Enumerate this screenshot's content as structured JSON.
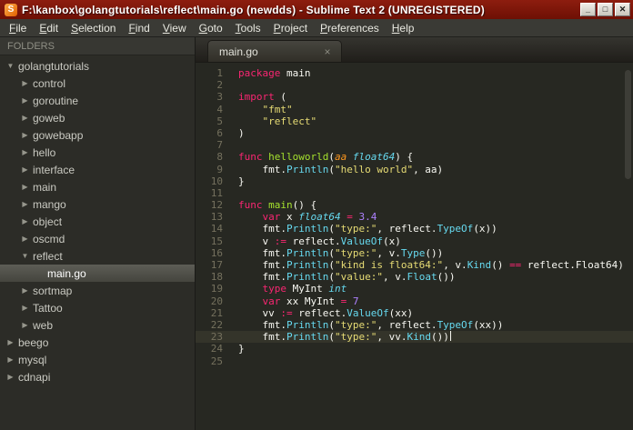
{
  "window": {
    "title": "F:\\kanbox\\golangtutorials\\reflect\\main.go (newdds) - Sublime Text 2 (UNREGISTERED)",
    "app_icon_letter": "S",
    "minimize_label": "_",
    "maximize_label": "□",
    "close_label": "✕"
  },
  "menu": {
    "items": [
      "File",
      "Edit",
      "Selection",
      "Find",
      "View",
      "Goto",
      "Tools",
      "Project",
      "Preferences",
      "Help"
    ]
  },
  "sidebar": {
    "header": "FOLDERS",
    "items": [
      {
        "label": "golangtutorials",
        "depth": 0,
        "type": "folder",
        "expanded": true
      },
      {
        "label": "control",
        "depth": 1,
        "type": "folder",
        "expanded": false
      },
      {
        "label": "goroutine",
        "depth": 1,
        "type": "folder",
        "expanded": false
      },
      {
        "label": "goweb",
        "depth": 1,
        "type": "folder",
        "expanded": false
      },
      {
        "label": "gowebapp",
        "depth": 1,
        "type": "folder",
        "expanded": false
      },
      {
        "label": "hello",
        "depth": 1,
        "type": "folder",
        "expanded": false
      },
      {
        "label": "interface",
        "depth": 1,
        "type": "folder",
        "expanded": false
      },
      {
        "label": "main",
        "depth": 1,
        "type": "folder",
        "expanded": false
      },
      {
        "label": "mango",
        "depth": 1,
        "type": "folder",
        "expanded": false
      },
      {
        "label": "object",
        "depth": 1,
        "type": "folder",
        "expanded": false
      },
      {
        "label": "oscmd",
        "depth": 1,
        "type": "folder",
        "expanded": false
      },
      {
        "label": "reflect",
        "depth": 1,
        "type": "folder",
        "expanded": true
      },
      {
        "label": "main.go",
        "depth": 2,
        "type": "file",
        "selected": true
      },
      {
        "label": "sortmap",
        "depth": 1,
        "type": "folder",
        "expanded": false
      },
      {
        "label": "Tattoo",
        "depth": 1,
        "type": "folder",
        "expanded": false
      },
      {
        "label": "web",
        "depth": 1,
        "type": "folder",
        "expanded": false
      },
      {
        "label": "beego",
        "depth": 0,
        "type": "folder",
        "expanded": false
      },
      {
        "label": "mysql",
        "depth": 0,
        "type": "folder",
        "expanded": false
      },
      {
        "label": "cdnapi",
        "depth": 0,
        "type": "folder",
        "expanded": false
      }
    ]
  },
  "tabs": [
    {
      "label": "main.go",
      "close": "×",
      "active": true
    }
  ],
  "editor": {
    "language": "go",
    "current_line": 23,
    "lines": [
      {
        "num": 1,
        "tokens": [
          {
            "c": "kw",
            "t": "package"
          },
          {
            "c": "pl",
            "t": " main"
          }
        ]
      },
      {
        "num": 2,
        "tokens": []
      },
      {
        "num": 3,
        "tokens": [
          {
            "c": "kw",
            "t": "import"
          },
          {
            "c": "pl",
            "t": " ("
          }
        ]
      },
      {
        "num": 4,
        "tokens": [
          {
            "c": "pl",
            "t": "    "
          },
          {
            "c": "st",
            "t": "\"fmt\""
          }
        ]
      },
      {
        "num": 5,
        "tokens": [
          {
            "c": "pl",
            "t": "    "
          },
          {
            "c": "st",
            "t": "\"reflect\""
          }
        ]
      },
      {
        "num": 6,
        "tokens": [
          {
            "c": "pl",
            "t": ")"
          }
        ]
      },
      {
        "num": 7,
        "tokens": []
      },
      {
        "num": 8,
        "tokens": [
          {
            "c": "kw",
            "t": "func"
          },
          {
            "c": "pl",
            "t": " "
          },
          {
            "c": "fn",
            "t": "helloworld"
          },
          {
            "c": "pl",
            "t": "("
          },
          {
            "c": "pa",
            "t": "aa"
          },
          {
            "c": "pl",
            "t": " "
          },
          {
            "c": "ty",
            "t": "float64"
          },
          {
            "c": "pl",
            "t": ") {"
          }
        ]
      },
      {
        "num": 9,
        "tokens": [
          {
            "c": "pl",
            "t": "    fmt."
          },
          {
            "c": "cy",
            "t": "Println"
          },
          {
            "c": "pl",
            "t": "("
          },
          {
            "c": "st",
            "t": "\"hello world\""
          },
          {
            "c": "pl",
            "t": ", aa)"
          }
        ]
      },
      {
        "num": 10,
        "tokens": [
          {
            "c": "pl",
            "t": "}"
          }
        ]
      },
      {
        "num": 11,
        "tokens": []
      },
      {
        "num": 12,
        "tokens": [
          {
            "c": "kw",
            "t": "func"
          },
          {
            "c": "pl",
            "t": " "
          },
          {
            "c": "fn",
            "t": "main"
          },
          {
            "c": "pl",
            "t": "() {"
          }
        ]
      },
      {
        "num": 13,
        "tokens": [
          {
            "c": "pl",
            "t": "    "
          },
          {
            "c": "kw",
            "t": "var"
          },
          {
            "c": "pl",
            "t": " x "
          },
          {
            "c": "ty",
            "t": "float64"
          },
          {
            "c": "pl",
            "t": " "
          },
          {
            "c": "kw",
            "t": "="
          },
          {
            "c": "pl",
            "t": " "
          },
          {
            "c": "nu",
            "t": "3.4"
          }
        ]
      },
      {
        "num": 14,
        "tokens": [
          {
            "c": "pl",
            "t": "    fmt."
          },
          {
            "c": "cy",
            "t": "Println"
          },
          {
            "c": "pl",
            "t": "("
          },
          {
            "c": "st",
            "t": "\"type:\""
          },
          {
            "c": "pl",
            "t": ", reflect."
          },
          {
            "c": "cy",
            "t": "TypeOf"
          },
          {
            "c": "pl",
            "t": "(x))"
          }
        ]
      },
      {
        "num": 15,
        "tokens": [
          {
            "c": "pl",
            "t": "    v "
          },
          {
            "c": "kw",
            "t": ":="
          },
          {
            "c": "pl",
            "t": " reflect."
          },
          {
            "c": "cy",
            "t": "ValueOf"
          },
          {
            "c": "pl",
            "t": "(x)"
          }
        ]
      },
      {
        "num": 16,
        "tokens": [
          {
            "c": "pl",
            "t": "    fmt."
          },
          {
            "c": "cy",
            "t": "Println"
          },
          {
            "c": "pl",
            "t": "("
          },
          {
            "c": "st",
            "t": "\"type:\""
          },
          {
            "c": "pl",
            "t": ", v."
          },
          {
            "c": "cy",
            "t": "Type"
          },
          {
            "c": "pl",
            "t": "())"
          }
        ]
      },
      {
        "num": 17,
        "tokens": [
          {
            "c": "pl",
            "t": "    fmt."
          },
          {
            "c": "cy",
            "t": "Println"
          },
          {
            "c": "pl",
            "t": "("
          },
          {
            "c": "st",
            "t": "\"kind is float64:\""
          },
          {
            "c": "pl",
            "t": ", v."
          },
          {
            "c": "cy",
            "t": "Kind"
          },
          {
            "c": "pl",
            "t": "() "
          },
          {
            "c": "kw",
            "t": "=="
          },
          {
            "c": "pl",
            "t": " reflect.Float64)"
          }
        ]
      },
      {
        "num": 18,
        "tokens": [
          {
            "c": "pl",
            "t": "    fmt."
          },
          {
            "c": "cy",
            "t": "Println"
          },
          {
            "c": "pl",
            "t": "("
          },
          {
            "c": "st",
            "t": "\"value:\""
          },
          {
            "c": "pl",
            "t": ", v."
          },
          {
            "c": "cy",
            "t": "Float"
          },
          {
            "c": "pl",
            "t": "())"
          }
        ]
      },
      {
        "num": 19,
        "tokens": [
          {
            "c": "pl",
            "t": "    "
          },
          {
            "c": "kw",
            "t": "type"
          },
          {
            "c": "pl",
            "t": " MyInt "
          },
          {
            "c": "ty",
            "t": "int"
          }
        ]
      },
      {
        "num": 20,
        "tokens": [
          {
            "c": "pl",
            "t": "    "
          },
          {
            "c": "kw",
            "t": "var"
          },
          {
            "c": "pl",
            "t": " xx MyInt "
          },
          {
            "c": "kw",
            "t": "="
          },
          {
            "c": "pl",
            "t": " "
          },
          {
            "c": "nu",
            "t": "7"
          }
        ]
      },
      {
        "num": 21,
        "tokens": [
          {
            "c": "pl",
            "t": "    vv "
          },
          {
            "c": "kw",
            "t": ":="
          },
          {
            "c": "pl",
            "t": " reflect."
          },
          {
            "c": "cy",
            "t": "ValueOf"
          },
          {
            "c": "pl",
            "t": "(xx)"
          }
        ]
      },
      {
        "num": 22,
        "tokens": [
          {
            "c": "pl",
            "t": "    fmt."
          },
          {
            "c": "cy",
            "t": "Println"
          },
          {
            "c": "pl",
            "t": "("
          },
          {
            "c": "st",
            "t": "\"type:\""
          },
          {
            "c": "pl",
            "t": ", reflect."
          },
          {
            "c": "cy",
            "t": "TypeOf"
          },
          {
            "c": "pl",
            "t": "(xx))"
          }
        ]
      },
      {
        "num": 23,
        "tokens": [
          {
            "c": "pl",
            "t": "    fmt."
          },
          {
            "c": "cy",
            "t": "Println"
          },
          {
            "c": "pl",
            "t": "("
          },
          {
            "c": "st",
            "t": "\"type:\""
          },
          {
            "c": "pl",
            "t": ", vv."
          },
          {
            "c": "cy",
            "t": "Kind"
          },
          {
            "c": "pl",
            "t": "())"
          }
        ]
      },
      {
        "num": 24,
        "tokens": [
          {
            "c": "pl",
            "t": "}"
          }
        ]
      },
      {
        "num": 25,
        "tokens": []
      }
    ]
  },
  "colors": {
    "titlebar_red": "#7c1608",
    "editor_background": "#272822",
    "keyword_pink": "#f92672",
    "string_yellow": "#e6db74",
    "type_cyan": "#66d9ef",
    "function_green": "#a6e22e",
    "number_purple": "#ae81ff",
    "param_orange": "#fd971f",
    "plain_text": "#f8f8f2",
    "line_number_gray": "#75715e"
  }
}
